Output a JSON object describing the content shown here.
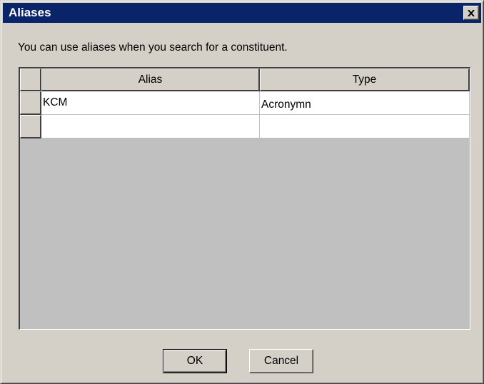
{
  "window": {
    "title": "Aliases"
  },
  "description": "You can use aliases when you search for a constituent.",
  "grid": {
    "columns": [
      "Alias",
      "Type"
    ],
    "rows": [
      {
        "alias": "KCM",
        "type": "Acronymn"
      },
      {
        "alias": "",
        "type": ""
      }
    ]
  },
  "buttons": {
    "ok": "OK",
    "cancel": "Cancel"
  },
  "icons": {
    "close": "close-icon"
  },
  "colors": {
    "titlebar": "#0a246a",
    "face": "#d4d0c8",
    "grid_bg": "#c0c0c0"
  }
}
